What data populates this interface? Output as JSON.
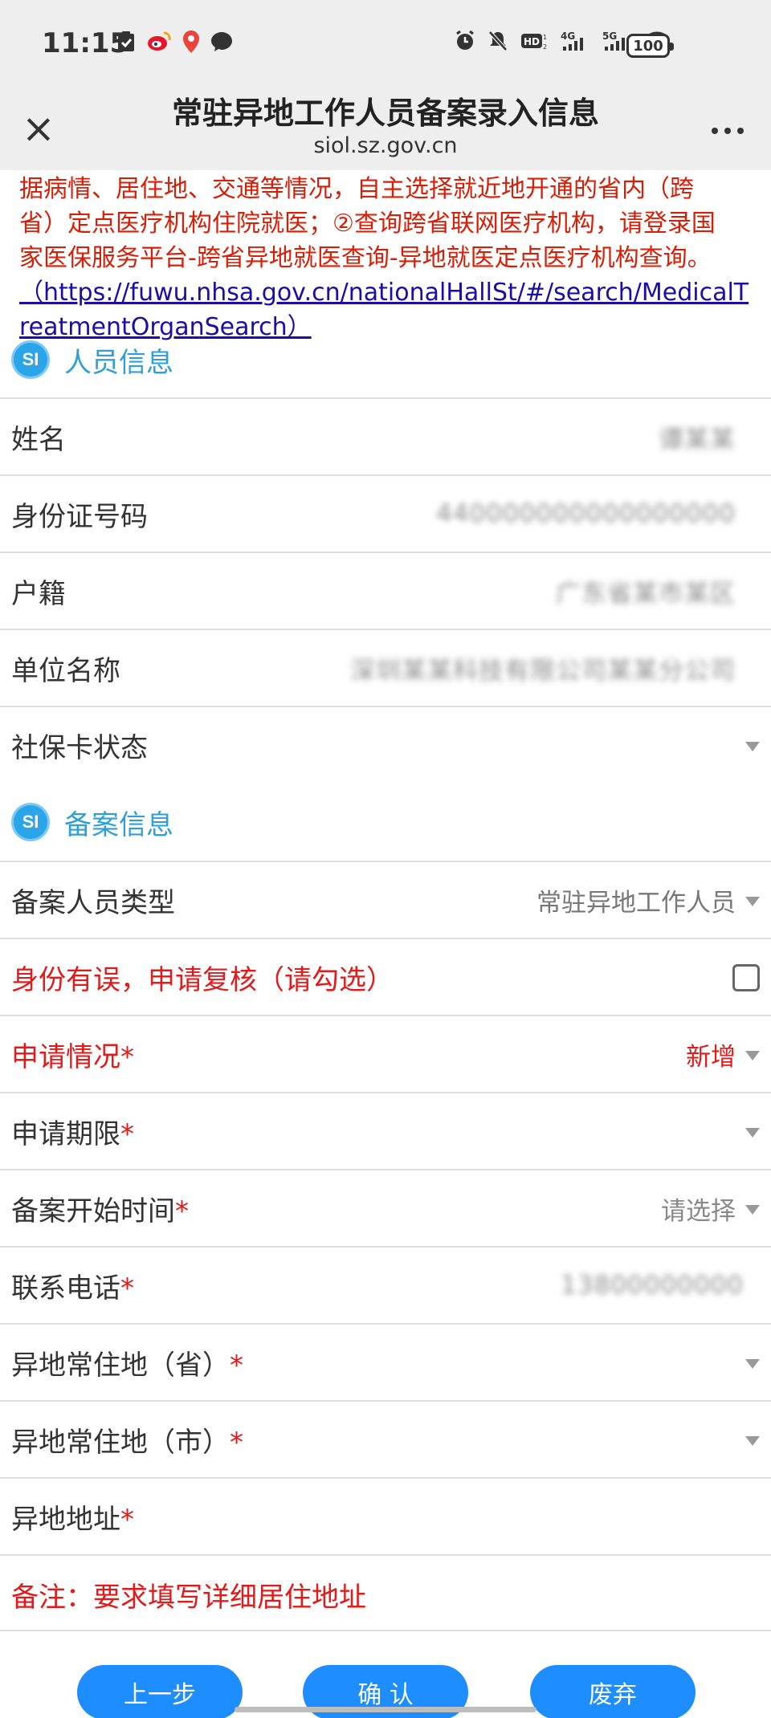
{
  "status_bar": {
    "time": "11:15",
    "battery": "100",
    "left_icons": [
      "check-icon",
      "weibo-icon",
      "map-pin-icon",
      "chat-icon"
    ],
    "right_icons": [
      "alarm-icon",
      "mute-icon",
      "hd-icon",
      "4g-icon",
      "5g-icon",
      "wifi-icon"
    ]
  },
  "app_bar": {
    "title": "常驻异地工作人员备案录入信息",
    "subtitle": "siol.sz.gov.cn"
  },
  "notice": {
    "line1": "据病情、居住地、交通等情况，自主选择就近地开通的省内（跨",
    "line2": "省）定点医疗机构住院就医；②查询跨省联网医疗机构，请登录国",
    "line3": "家医保服务平台-跨省异地就医查询-异地就医定点医疗机构查询。",
    "link_text": "（https://fuwu.nhsa.gov.cn/nationalHallSt/#/search/MedicalTreatmentOrganSearch）"
  },
  "sections": {
    "personal": {
      "icon_text": "SI",
      "title": "人员信息"
    },
    "filing": {
      "icon_text": "SI",
      "title": "备案信息"
    }
  },
  "personal_fields": {
    "name": {
      "label": "姓名",
      "value": "谭某某"
    },
    "id_number": {
      "label": "身份证号码",
      "value": "440000000000000000"
    },
    "household": {
      "label": "户籍",
      "value": "广东省某市某区"
    },
    "company": {
      "label": "单位名称",
      "value": "深圳某某科技有限公司某某分公司"
    },
    "card_status": {
      "label": "社保卡状态",
      "value": ""
    }
  },
  "filing_fields": {
    "person_type": {
      "label": "备案人员类型",
      "value": "常驻异地工作人员"
    },
    "identity_review": {
      "label": "身份有误，申请复核（请勾选）"
    },
    "application_status": {
      "label": "申请情况",
      "value": "新增",
      "required": "*"
    },
    "application_period": {
      "label": "申请期限",
      "value": "",
      "required": "*"
    },
    "start_time": {
      "label": "备案开始时间",
      "value": "请选择",
      "required": "*"
    },
    "phone": {
      "label": "联系电话",
      "value": "13800000000",
      "required": "*"
    },
    "province": {
      "label": "异地常住地（省）",
      "value": "",
      "required": "*"
    },
    "city": {
      "label": "异地常住地（市）",
      "value": "",
      "required": "*"
    },
    "address": {
      "label": "异地地址",
      "value": "",
      "required": "*"
    }
  },
  "remark": "备注：要求填写详细居住地址",
  "buttons": {
    "back": "上一步",
    "confirm": "确 认",
    "discard": "废弃"
  },
  "colors": {
    "accent_blue": "#1d8dff",
    "section_blue": "#2aa5e8",
    "warning_red": "#e21a1a",
    "link_blue": "#1a0dab"
  }
}
